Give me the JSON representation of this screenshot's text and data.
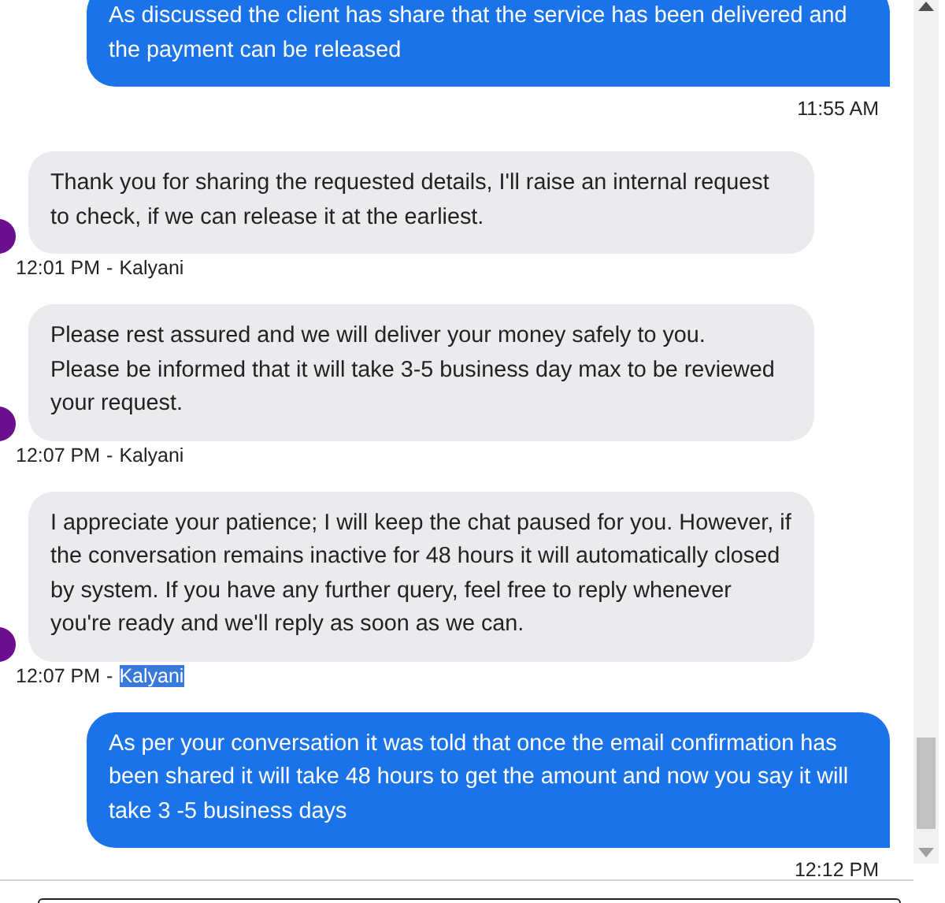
{
  "messages": [
    {
      "kind": "user",
      "text": "As discussed the client has share that the service has been delivered and the payment can be released",
      "time": "11:55 AM"
    },
    {
      "kind": "agent",
      "text": "Thank you for sharing the requested details, I'll raise an internal request to check, if we can release it at the earliest.",
      "time": "12:01 PM",
      "separator": "-",
      "sender": "Kalyani",
      "sender_highlighted": false
    },
    {
      "kind": "agent",
      "text": "Please rest assured and we will deliver your money safely to you.\nPlease be informed that it will take 3-5 business day max to be reviewed your request.",
      "time": "12:07 PM",
      "separator": "-",
      "sender": "Kalyani",
      "sender_highlighted": false
    },
    {
      "kind": "agent",
      "text": "I appreciate your patience; I will keep the chat paused for you. However, if the conversation remains inactive for 48 hours it will automatically closed by system. If you have any further query, feel free to reply whenever you're ready and we'll reply as soon as we can.",
      "time": "12:07 PM",
      "separator": "-",
      "sender": "Kalyani",
      "sender_highlighted": true
    },
    {
      "kind": "user",
      "text": "As per your conversation it was told that once the email confirmation has been shared it will take 48 hours to get the amount and now you say it will take 3 -5 business days",
      "time": "12:12 PM"
    }
  ]
}
